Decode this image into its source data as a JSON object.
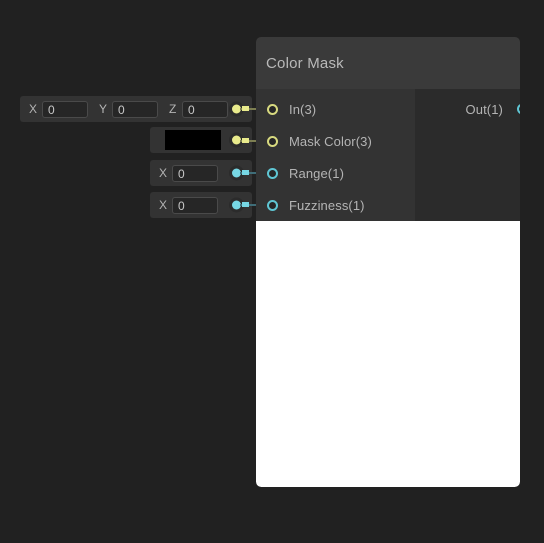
{
  "theme": {
    "background": "#212121",
    "node_title_bg": "#3a3a3a",
    "node_input_bg": "#333333",
    "node_output_bg": "#2b2b2b",
    "field_bg": "#262626",
    "text": "#b4b4b4",
    "yellow_port": "#d8da80",
    "cyan_port": "#5fc6d4",
    "preview_bg": "#ffffff",
    "swatch_color": "#000000"
  },
  "node": {
    "title": "Color Mask",
    "inputs": [
      {
        "label": "In(3)",
        "type": "vector",
        "color": "yellow"
      },
      {
        "label": "Mask Color(3)",
        "type": "color",
        "color": "yellow"
      },
      {
        "label": "Range(1)",
        "type": "scalar",
        "color": "cyan"
      },
      {
        "label": "Fuzziness(1)",
        "type": "scalar",
        "color": "cyan"
      }
    ],
    "outputs": [
      {
        "label": "Out(1)",
        "color": "cyan"
      }
    ],
    "preview": {
      "fill": "#ffffff"
    }
  },
  "properties": {
    "vector3": {
      "axes": [
        {
          "label": "X",
          "value": "0"
        },
        {
          "label": "Y",
          "value": "0"
        },
        {
          "label": "Z",
          "value": "0"
        }
      ]
    },
    "mask_color": {
      "swatch": "#000000"
    },
    "range": {
      "axes": [
        {
          "label": "X",
          "value": "0"
        }
      ]
    },
    "fuzziness": {
      "axes": [
        {
          "label": "X",
          "value": "0"
        }
      ]
    }
  }
}
